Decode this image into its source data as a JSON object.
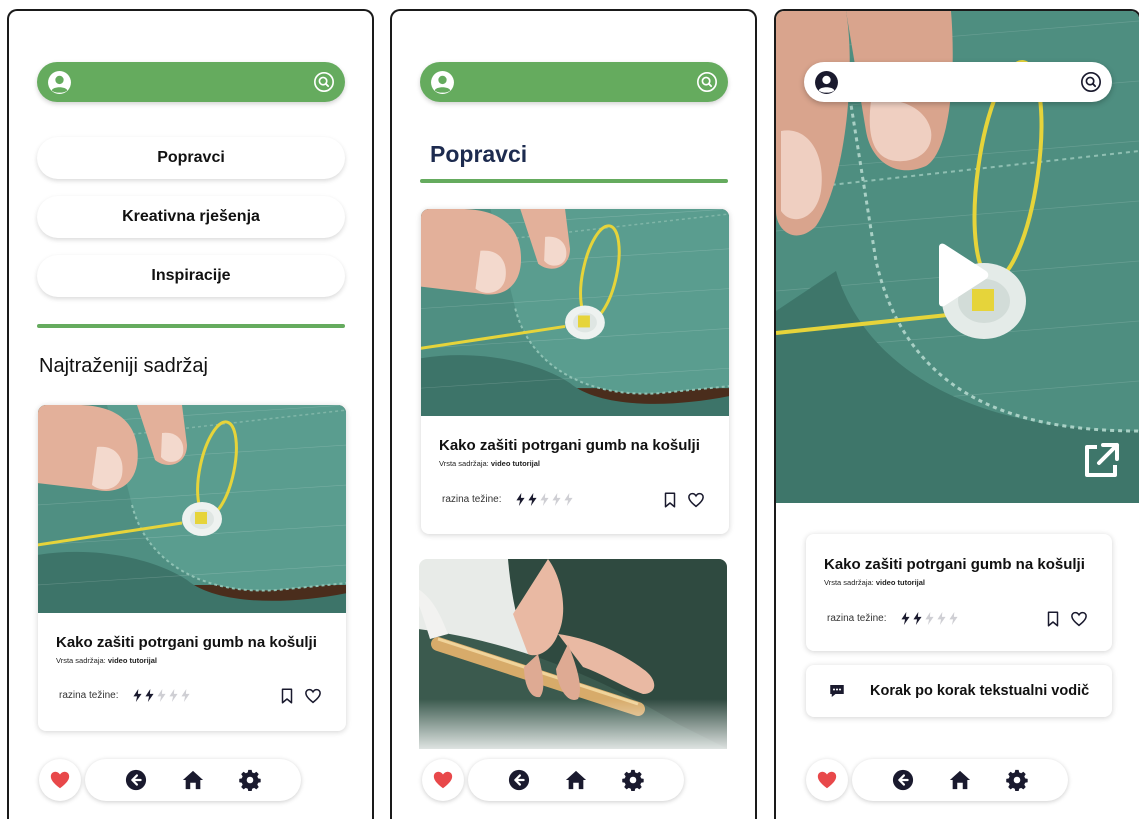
{
  "screen1": {
    "menu": [
      "Popravci",
      "Kreativna rješenja",
      "Inspiracije"
    ],
    "section_title": "Najtraženiji sadržaj",
    "card": {
      "title": "Kako zašiti potrgani gumb na košulji",
      "meta_prefix": "Vrsta sadržaja:",
      "meta_value": "video tutorijal",
      "difficulty_label": "razina težine:",
      "difficulty": 2,
      "difficulty_max": 5
    }
  },
  "screen2": {
    "page_title": "Popravci",
    "card": {
      "title": "Kako zašiti potrgani gumb na košulji",
      "meta_prefix": "Vrsta sadržaja:",
      "meta_value": "video tutorijal",
      "difficulty_label": "razina težine:",
      "difficulty": 2,
      "difficulty_max": 5
    }
  },
  "screen3": {
    "card": {
      "title": "Kako zašiti potrgani gumb na košulji",
      "meta_prefix": "Vrsta sadržaja:",
      "meta_value": "video tutorijal",
      "difficulty_label": "razina težine:",
      "difficulty": 2,
      "difficulty_max": 5
    },
    "guide_label": "Korak po korak tekstualni vodič"
  },
  "icons": {
    "avatar": "user-avatar-icon",
    "search": "search-icon",
    "heart_nav": "heart-icon",
    "back": "back-arrow-icon",
    "home": "home-icon",
    "settings": "gear-icon",
    "bookmark": "bookmark-icon",
    "like": "heart-outline-icon",
    "play": "play-icon",
    "external": "external-link-icon",
    "chat": "chat-icon",
    "difficulty": "bolt-icon"
  },
  "colors": {
    "accent_green": "#65ab5e",
    "navy": "#1d2b4f",
    "heart_red": "#e8484a",
    "dark_icon": "#1a1a2e"
  }
}
